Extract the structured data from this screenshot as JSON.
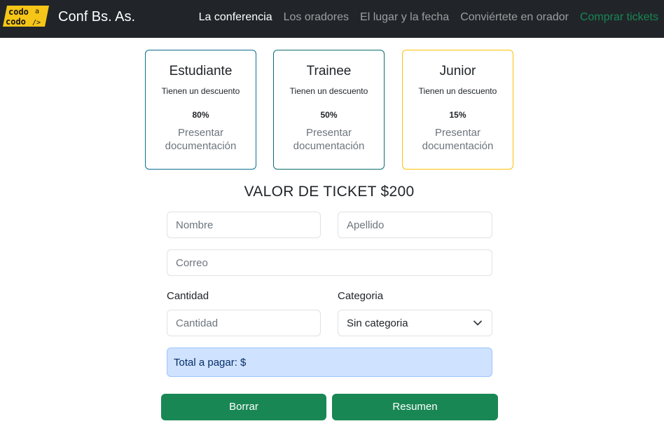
{
  "navbar": {
    "logo_text_top": "codo",
    "logo_text_a": "a",
    "logo_text_bottom": "codo",
    "logo_slash": "/>",
    "brand": "Conf Bs. As.",
    "links": [
      "La conferencia",
      "Los oradores",
      "El lugar y la fecha",
      "Conviértete en orador",
      "Comprar tickets"
    ]
  },
  "cards": [
    {
      "title": "Estudiante",
      "text": "Tienen un descuento",
      "discount": "80%",
      "doc": "Presentar documentación"
    },
    {
      "title": "Trainee",
      "text": "Tienen un descuento",
      "discount": "50%",
      "doc": "Presentar documentación"
    },
    {
      "title": "Junior",
      "text": "Tienen un descuento",
      "discount": "15%",
      "doc": "Presentar documentación"
    }
  ],
  "ticket_title": "VALOR DE TICKET $200",
  "form": {
    "nombre_placeholder": "Nombre",
    "apellido_placeholder": "Apellido",
    "correo_placeholder": "Correo",
    "cantidad_label": "Cantidad",
    "cantidad_placeholder": "Cantidad",
    "categoria_label": "Categoria",
    "categoria_value": "Sin categoria",
    "total": "Total a pagar: $",
    "borrar": "Borrar",
    "resumen": "Resumen"
  },
  "colors": {
    "navbar_bg": "#212529",
    "logo_yellow": "#f5c518",
    "buy_link": "#198754",
    "button": "#198754",
    "total_bg": "#cfe2ff",
    "junior_border": "#ffc107"
  }
}
